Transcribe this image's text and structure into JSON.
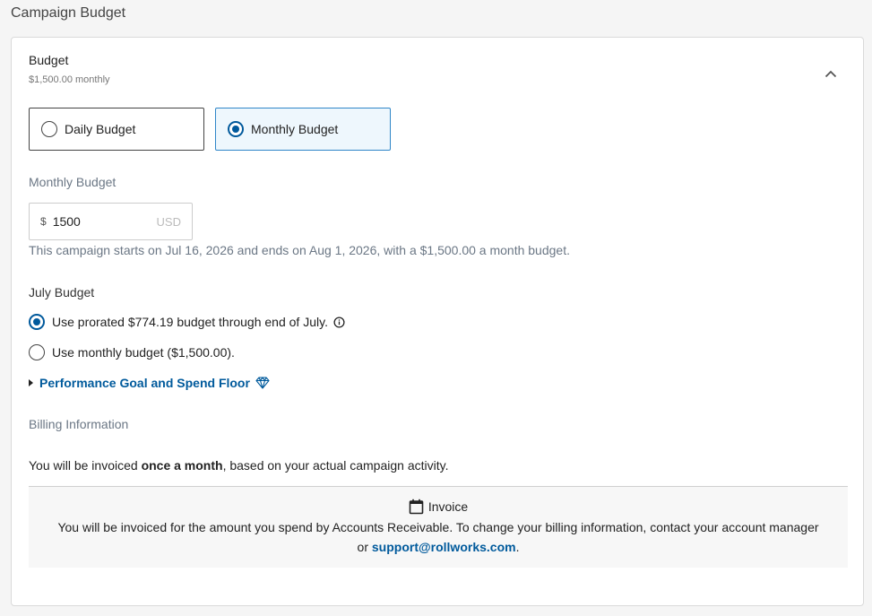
{
  "section_title": "Campaign Budget",
  "budget": {
    "title": "Budget",
    "summary": "$1,500.00 monthly",
    "options": {
      "daily": "Daily Budget",
      "monthly": "Monthly Budget"
    },
    "selected": "monthly"
  },
  "monthly_budget": {
    "label": "Monthly Budget",
    "currency_symbol": "$",
    "value": "1500",
    "unit": "USD",
    "note": "This campaign starts on Jul 16, 2026 and ends on Aug 1, 2026, with a $1,500.00 a month budget."
  },
  "july_budget": {
    "label": "July Budget",
    "option_prorated": "Use prorated $774.19 budget through end of July.",
    "option_monthly": "Use monthly budget ($1,500.00).",
    "selected": "prorated"
  },
  "performance": {
    "label": "Performance Goal and Spend Floor"
  },
  "billing": {
    "label": "Billing Information",
    "invoice_prefix": "You will be invoiced ",
    "invoice_bold": "once a month",
    "invoice_suffix": ", based on your actual campaign activity.",
    "box_title": "Invoice",
    "box_text": "You will be invoiced for the amount you spend by Accounts Receivable. To change your billing information, contact your account manager or ",
    "support_link": "support@rollworks.com",
    "box_text_end": "."
  },
  "icons": {
    "collapse": "chevron-up-icon",
    "info": "info-icon",
    "gem": "diamond-icon",
    "calendar": "calendar-icon"
  },
  "colors": {
    "accent": "#005a9c",
    "selected_border": "#2f86c8",
    "selected_bg": "#eef7fd",
    "muted_text": "#6b7785"
  }
}
